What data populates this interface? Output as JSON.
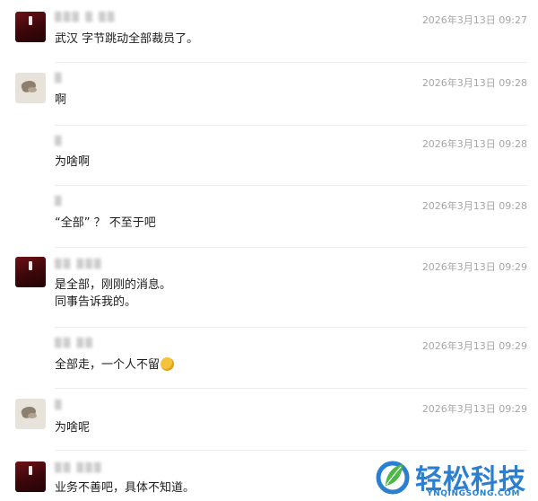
{
  "messages": [
    {
      "name": "▒▒▒ ▒ ▒▒",
      "time": "2026年3月13日 09:27",
      "text": "武汉 字节跳动全部裁员了。"
    },
    {
      "name": "▒",
      "time": "2026年3月13日 09:28",
      "text": "啊"
    },
    {
      "name": "▒",
      "time": "2026年3月13日 09:28",
      "text": "为啥啊"
    },
    {
      "name": "▒",
      "time": "2026年3月13日 09:28",
      "text": "“全部” ？ 不至于吧"
    },
    {
      "name": "▒▒ ▒▒▒",
      "time": "2026年3月13日 09:29",
      "text": "是全部，刚刚的消息。",
      "text2": "同事告诉我的。"
    },
    {
      "name": "▒▒ ▒▒",
      "time": "2026年3月13日 09:29",
      "text": "全部走，一个人不留",
      "emoji": "sweat-smile-emoji"
    },
    {
      "name": "▒",
      "time": "2026年3月13日 09:29",
      "text": "为啥呢"
    },
    {
      "name": "▒▒ ▒▒▒",
      "time": "",
      "text": "业务不善吧，具体不知道。"
    }
  ],
  "watermark": {
    "title": "轻松科技",
    "url": "YNQINGSONG.COM",
    "color": "#2a7fd0"
  },
  "colors": {
    "timestamp": "#a6a6a6",
    "divider": "#ededed",
    "avatar_red": "#6e1216",
    "avatar_beige": "#e7e3db"
  }
}
